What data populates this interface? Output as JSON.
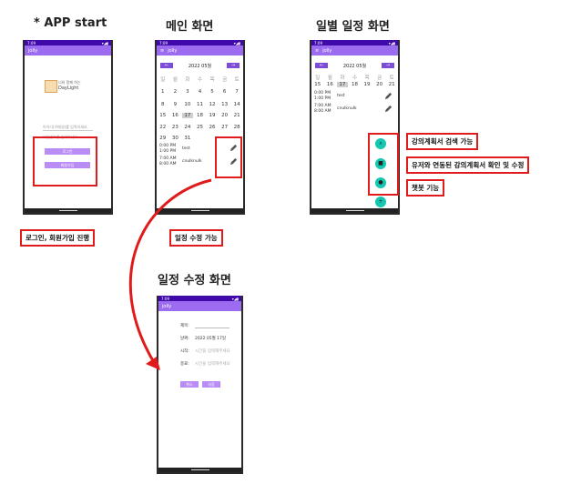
{
  "titles": {
    "app_start": "* APP start",
    "main": "메인 화면",
    "daily": "일별 일정 화면",
    "edit": "일정 수정 화면"
  },
  "status_bar": {
    "time": "7:09",
    "signal": "▾◢▮"
  },
  "app_name": "jolly",
  "login_screen": {
    "logo_line1": "너와 함께 하는",
    "logo_line2": "DayLight",
    "prompt1": "아이디(이메일)를 입력하세요",
    "prompt2": "비밀번호를 입력하세요",
    "login_button": "로그인",
    "signup_button": "회원가입"
  },
  "main_screen": {
    "month": "2022 05월",
    "prev": "←",
    "next": "→",
    "weekdays": [
      "일",
      "월",
      "화",
      "수",
      "목",
      "금",
      "토"
    ],
    "weeks": [
      [
        "1",
        "2",
        "3",
        "4",
        "5",
        "6",
        "7"
      ],
      [
        "8",
        "9",
        "10",
        "11",
        "12",
        "13",
        "14"
      ],
      [
        "15",
        "16",
        "17",
        "18",
        "19",
        "20",
        "21"
      ],
      [
        "22",
        "23",
        "24",
        "25",
        "26",
        "27",
        "28"
      ],
      [
        "29",
        "30",
        "31",
        "",
        "",
        "",
        ""
      ]
    ],
    "selected_day": "17",
    "events": [
      {
        "time1": "0:00 PM",
        "time2": "1:00 PM",
        "title": "test"
      },
      {
        "time1": "7:00 AM",
        "time2": "8:00 AM",
        "title": "cnulknulk"
      }
    ]
  },
  "daily_screen": {
    "month": "2022 05월",
    "week": [
      "15",
      "16",
      "17",
      "18",
      "19",
      "20",
      "21"
    ],
    "fab_icons": [
      "search-icon",
      "book-icon",
      "chat-icon",
      "add-icon"
    ]
  },
  "edit_screen": {
    "title_label": "제목:",
    "date_label": "날짜:",
    "date_value": "2022 05월 17일",
    "start_label": "시작:",
    "start_hint": "시간을 입력해주세요",
    "end_label": "종료:",
    "end_hint": "시간을 입력해주세요",
    "cancel_button": "취소",
    "save_button": "저장"
  },
  "annotations": {
    "login": "로그인, 회원가입 진행",
    "edit": "일정 수정 가능",
    "search": "강의계획서 검색 가능",
    "linked": "유저와 연동된 강의계획서 확인 및 수정",
    "chatbot": "챗봇 기능"
  },
  "colors": {
    "accent": "#9c6cf0",
    "status": "#3f0aa9",
    "highlight": "#e01b1b",
    "fab": "#13c7b0"
  }
}
